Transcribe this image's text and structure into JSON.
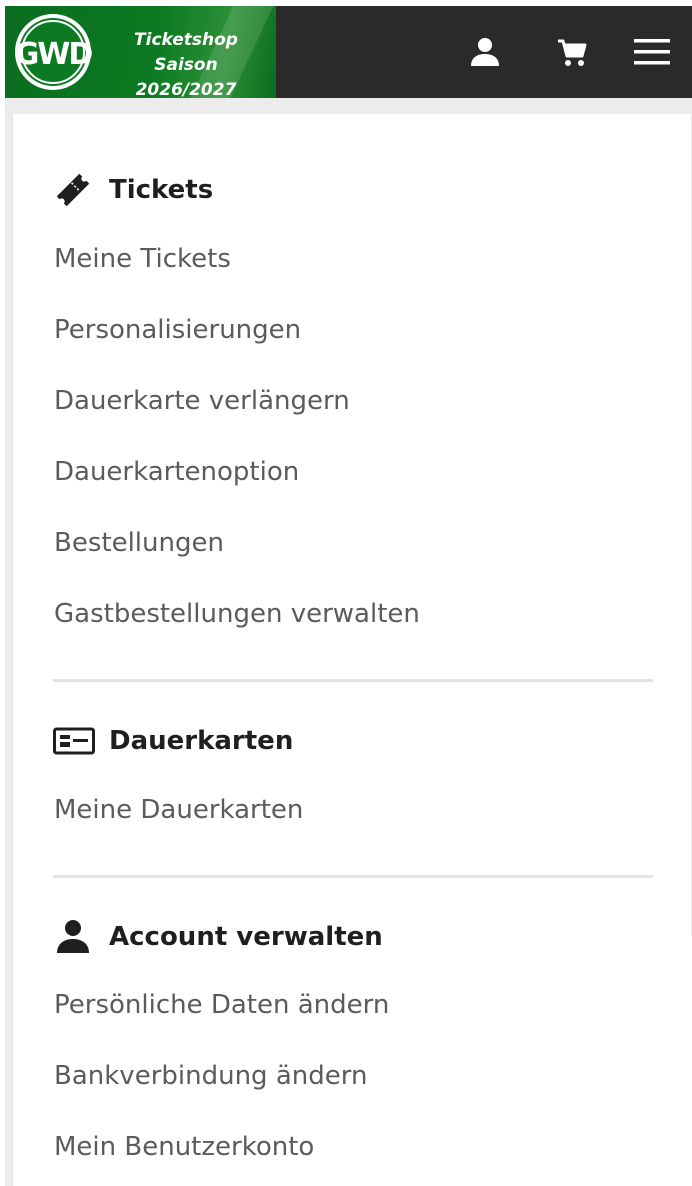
{
  "header": {
    "brand_line1": "Ticketshop",
    "brand_line2": "Saison 2026/2027",
    "logo_text": "GWD",
    "icons": [
      "user-icon",
      "cart-icon",
      "menu-icon"
    ],
    "colors": {
      "brand_green": "#0b7a22",
      "header_bg": "#2a2a2a"
    }
  },
  "sections": {
    "tickets": {
      "title": "Tickets",
      "icon": "ticket-icon",
      "items": [
        "Meine Tickets",
        "Personalisierungen",
        "Dauerkarte verlängern",
        "Dauerkartenoption",
        "Bestellungen",
        "Gastbestellungen verwalten"
      ]
    },
    "dauerkarten": {
      "title": "Dauerkarten",
      "icon": "id-card-icon",
      "items": [
        "Meine Dauerkarten"
      ]
    },
    "account": {
      "title": "Account verwalten",
      "icon": "person-icon",
      "items": [
        "Persönliche Daten ändern",
        "Bankverbindung ändern",
        "Mein Benutzerkonto"
      ]
    }
  }
}
